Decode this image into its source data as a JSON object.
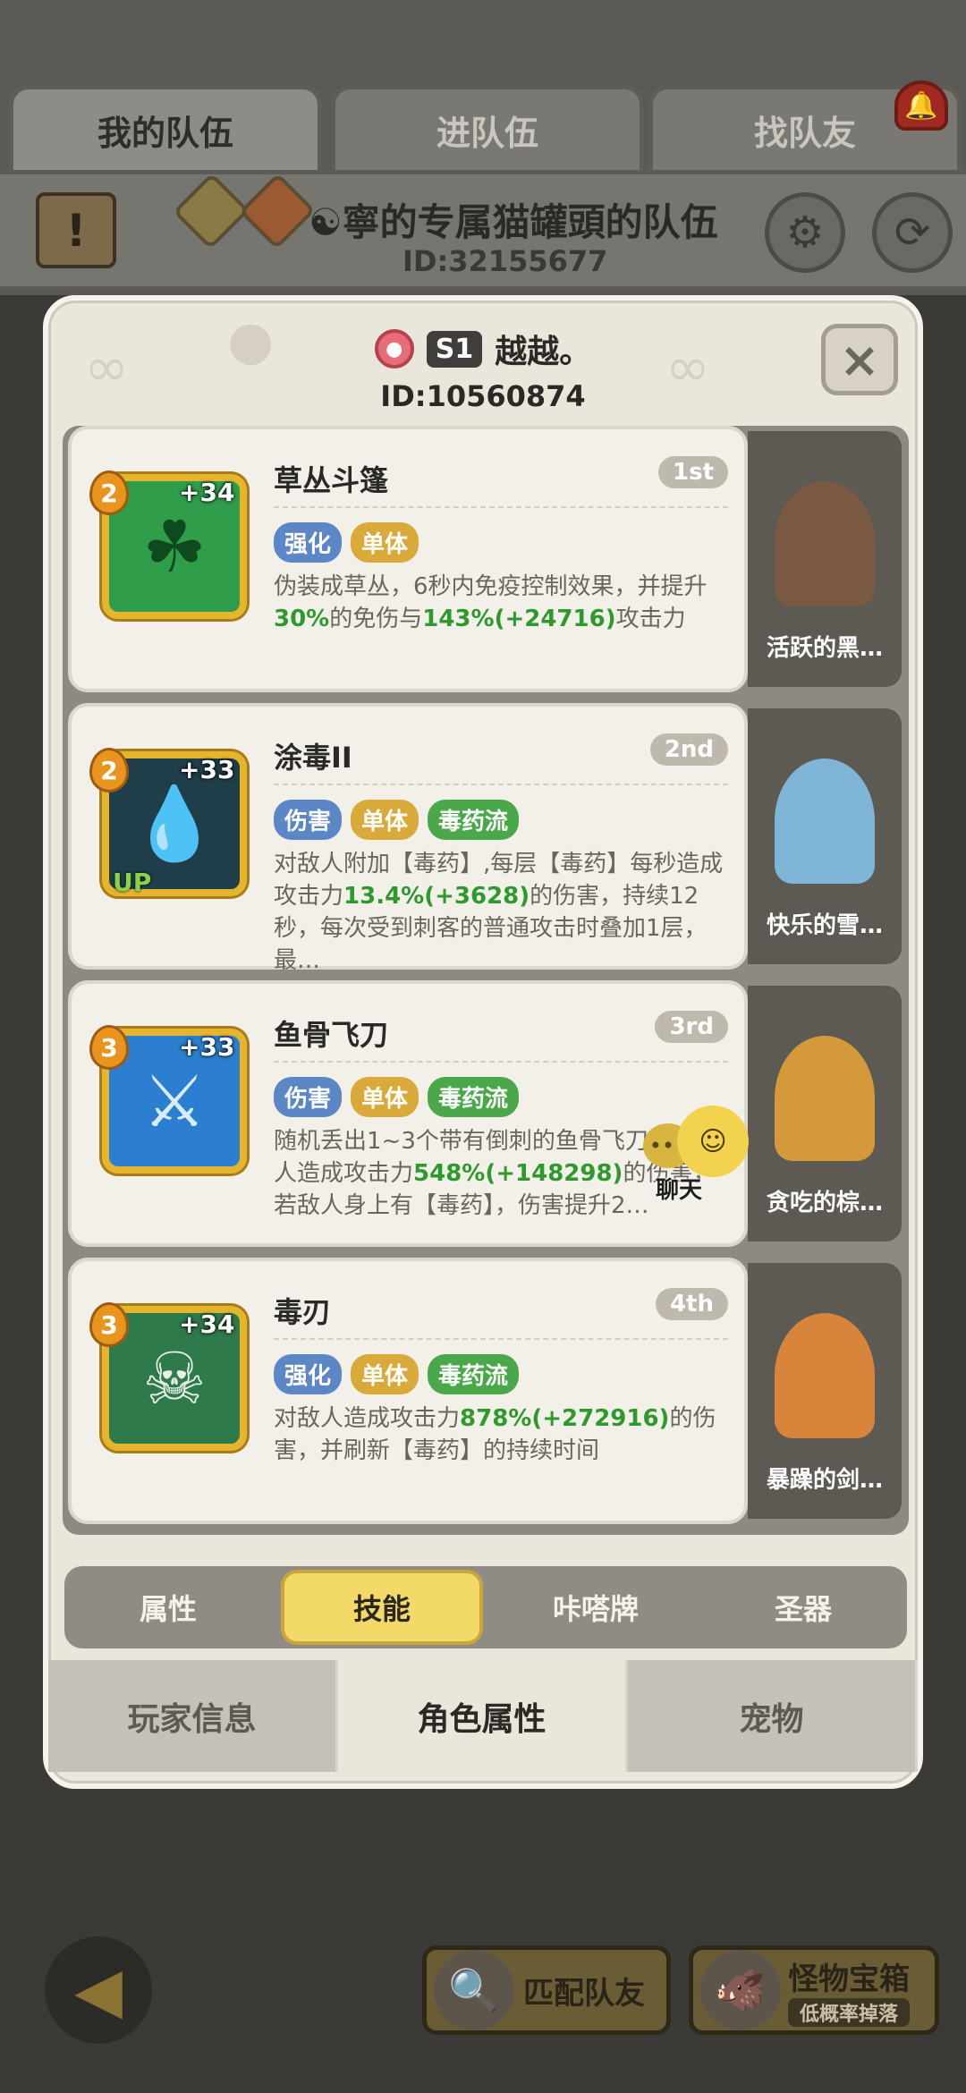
{
  "top_tabs": [
    "我的队伍",
    "进队伍",
    "找队友"
  ],
  "team": {
    "name": "☯寧的专属猫罐頭的队伍",
    "id": "ID:32155677"
  },
  "notice_icon": "!",
  "player": {
    "server": "S1",
    "name": "越越。",
    "id": "ID:10560874"
  },
  "close_label": "×",
  "skills": [
    {
      "title": "草丛斗篷",
      "rank": "1st",
      "level": "2",
      "plus": "+34",
      "tags": [
        {
          "text": "强化",
          "color": "#5c86c6"
        },
        {
          "text": "单体",
          "color": "#d9aa3a"
        }
      ],
      "desc": [
        "伪装成草丛，6秒内免疫控制效果，并提升",
        "30%",
        "的免伤与",
        "143%(+24716)",
        "攻击力"
      ],
      "pet": "活跃的黑…"
    },
    {
      "title": "涂毒II",
      "rank": "2nd",
      "level": "2",
      "plus": "+33",
      "up": "UP",
      "tags": [
        {
          "text": "伤害",
          "color": "#5c86c6"
        },
        {
          "text": "单体",
          "color": "#d9aa3a"
        },
        {
          "text": "毒药流",
          "color": "#4aa84a"
        }
      ],
      "desc": [
        "对敌人附加【毒药】,每层【毒药】每秒造成攻击力",
        "13.4%(+3628)",
        "的伤害，持续12秒，每次受到刺客的普通攻击时叠加1层，最…",
        "",
        ""
      ],
      "pet": "快乐的雪…"
    },
    {
      "title": "鱼骨飞刀",
      "rank": "3rd",
      "level": "3",
      "plus": "+33",
      "tags": [
        {
          "text": "伤害",
          "color": "#5c86c6"
        },
        {
          "text": "单体",
          "color": "#d9aa3a"
        },
        {
          "text": "毒药流",
          "color": "#4aa84a"
        }
      ],
      "desc": [
        "随机丢出1~3个带有倒刺的鱼骨飞刀，对敌人造成攻击力",
        "548%(+148298)",
        "的伤害，若敌人身上有【毒药】，伤害提升2…",
        "",
        ""
      ],
      "pet": "贪吃的棕…"
    },
    {
      "title": "毒刃",
      "rank": "4th",
      "level": "3",
      "plus": "+34",
      "tags": [
        {
          "text": "强化",
          "color": "#5c86c6"
        },
        {
          "text": "单体",
          "color": "#d9aa3a"
        },
        {
          "text": "毒药流",
          "color": "#4aa84a"
        }
      ],
      "desc": [
        "对敌人造成攻击力",
        "878%(+272916)",
        "的伤害，并刷新【毒药】的持续时间",
        "",
        ""
      ],
      "pet": "暴躁的剑…"
    }
  ],
  "chat_label": "聊天",
  "category_tabs": [
    "属性",
    "技能",
    "咔嗒牌",
    "圣器"
  ],
  "category_active": "技能",
  "bottom_tabs": [
    "玩家信息",
    "角色属性",
    "宠物"
  ],
  "bottom_active": "角色属性",
  "footer": {
    "match_label": "匹配队友",
    "chest_label": "怪物宝箱",
    "chest_sub": "低概率掉落"
  }
}
